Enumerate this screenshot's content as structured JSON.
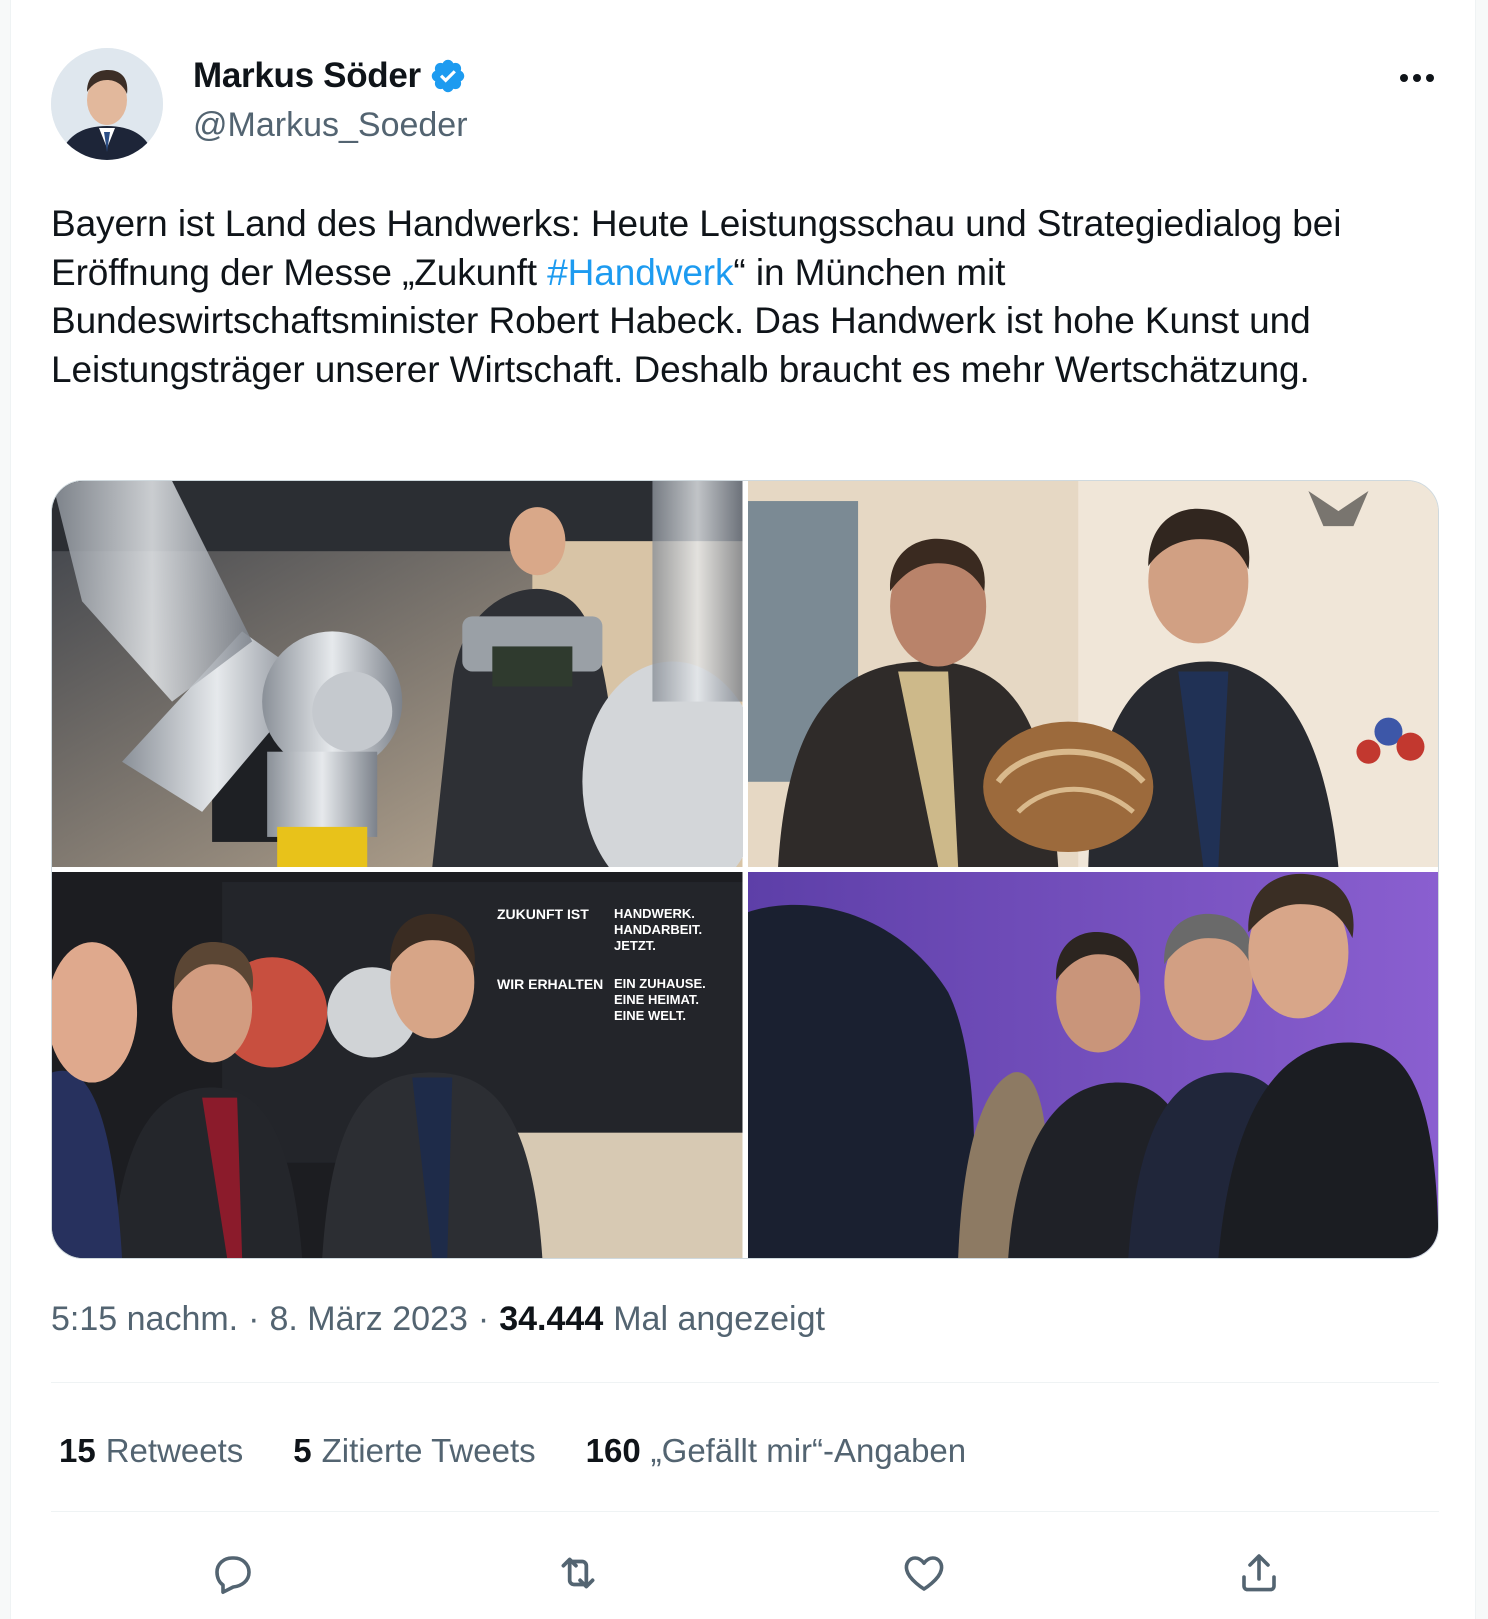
{
  "author": {
    "display_name": "Markus Söder",
    "handle": "@Markus_Soeder",
    "verified": true,
    "avatar_icon": "profile-photo"
  },
  "tweet": {
    "text_before_hashtag": "Bayern ist Land des Handwerks: Heute Leistungsschau und Strategiedialog bei Eröffnung der Messe „Zukunft ",
    "hashtag": "#Handwerk",
    "text_after_hashtag": "“ in München mit Bundeswirtschaftsminister Robert Habeck. Das Handwerk ist hohe Kunst und Leistungsträger unserer Wirtschaft. Deshalb braucht es mehr Wertschätzung."
  },
  "media": {
    "photos": [
      {
        "name": "photo-robot-arm-tablet"
      },
      {
        "name": "photo-bread-handover"
      },
      {
        "name": "photo-exhibition-booth"
      },
      {
        "name": "photo-panel-discussion"
      }
    ],
    "booth_sign": {
      "left_top": "ZUKUNFT IST",
      "left_bottom": "WIR ERHALTEN",
      "right_top_1": "HANDWERK.",
      "right_top_2": "HANDARBEIT.",
      "right_top_3": "JETZT.",
      "right_bottom_1": "EIN ZUHAUSE.",
      "right_bottom_2": "EINE HEIMAT.",
      "right_bottom_3": "EINE WELT."
    }
  },
  "meta": {
    "time": "5:15 nachm.",
    "separator": "·",
    "date": "8. März 2023",
    "views_count": "34.444",
    "views_label": "Mal angezeigt"
  },
  "stats": {
    "retweets_count": "15",
    "retweets_label": "Retweets",
    "quotes_count": "5",
    "quotes_label": "Zitierte Tweets",
    "likes_count": "160",
    "likes_label": "„Gefällt mir“-Angaben"
  },
  "actions": [
    "reply-icon",
    "retweet-icon",
    "like-icon",
    "share-icon"
  ],
  "colors": {
    "accent": "#1d9bf0",
    "text_primary": "#0f1419",
    "text_secondary": "#536471",
    "border": "#eff3f4"
  }
}
